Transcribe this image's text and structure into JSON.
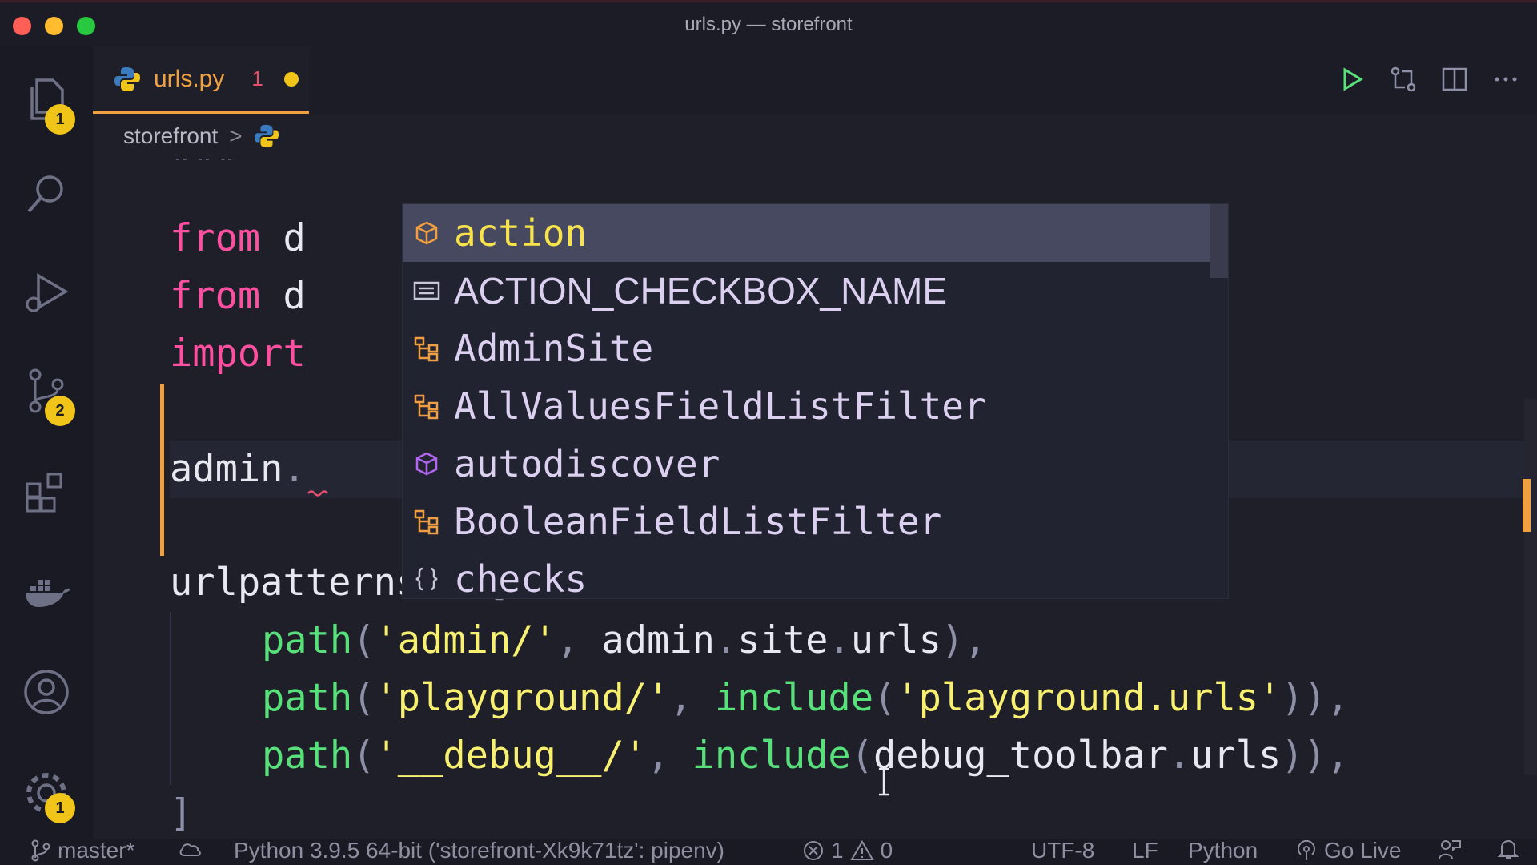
{
  "window": {
    "title": "urls.py — storefront"
  },
  "tab": {
    "label": "urls.py",
    "problem_count": "1"
  },
  "breadcrumb": {
    "folder": "storefront",
    "separator": ">"
  },
  "activity_badges": {
    "explorer": "1",
    "source_control": "2",
    "settings": "1"
  },
  "code": {
    "docstring": "\"\"\"",
    "line_from1": {
      "keyword": "from",
      "rest": "d"
    },
    "line_from2": {
      "keyword": "from",
      "rest": "d"
    },
    "line_import": {
      "keyword": "import"
    },
    "line_admin": {
      "text": "admin",
      "dot": "."
    },
    "line_urlpatterns": {
      "name": "urlpatterns",
      "op": "=",
      "bracket": "["
    },
    "path1": {
      "fn": "path",
      "open": "(",
      "str": "'admin/'",
      "comma": ",",
      "rest": "admin",
      "d1": ".",
      "site": "site",
      "d2": ".",
      "urls": "urls",
      "close": "),"
    },
    "path2": {
      "fn": "path",
      "open": "(",
      "str": "'playground/'",
      "comma": ",",
      "include": "include",
      "open2": "(",
      "str2": "'playground.urls'",
      "close": ")),"
    },
    "path3": {
      "fn": "path",
      "open": "(",
      "str": "'__debug__/'",
      "comma": ",",
      "include": "include",
      "open2": "(",
      "arg": "debug_toolbar",
      "dot": ".",
      "urls": "urls",
      "close": ")),"
    },
    "closing_bracket": "]"
  },
  "suggestions": [
    {
      "label": "action",
      "kind": "module-icon",
      "selected": true
    },
    {
      "label": "ACTION_CHECKBOX_NAME",
      "kind": "variable-icon"
    },
    {
      "label": "AdminSite",
      "kind": "class-icon"
    },
    {
      "label": "AllValuesFieldListFilter",
      "kind": "class-icon"
    },
    {
      "label": "autodiscover",
      "kind": "method-icon"
    },
    {
      "label": "BooleanFieldListFilter",
      "kind": "class-icon"
    },
    {
      "label": "checks",
      "kind": "namespace-icon"
    }
  ],
  "statusbar": {
    "branch": "master*",
    "interpreter": "Python 3.9.5 64-bit ('storefront-Xk9k71tz': pipenv)",
    "errors": "1",
    "warnings": "0",
    "encoding": "UTF-8",
    "eol": "LF",
    "language": "Python",
    "live": "Go Live"
  },
  "colors": {
    "keyword": "#ff4fa1",
    "function": "#58e07a",
    "string": "#f8f070",
    "accent": "#f0a040",
    "badge": "#f0c419"
  }
}
